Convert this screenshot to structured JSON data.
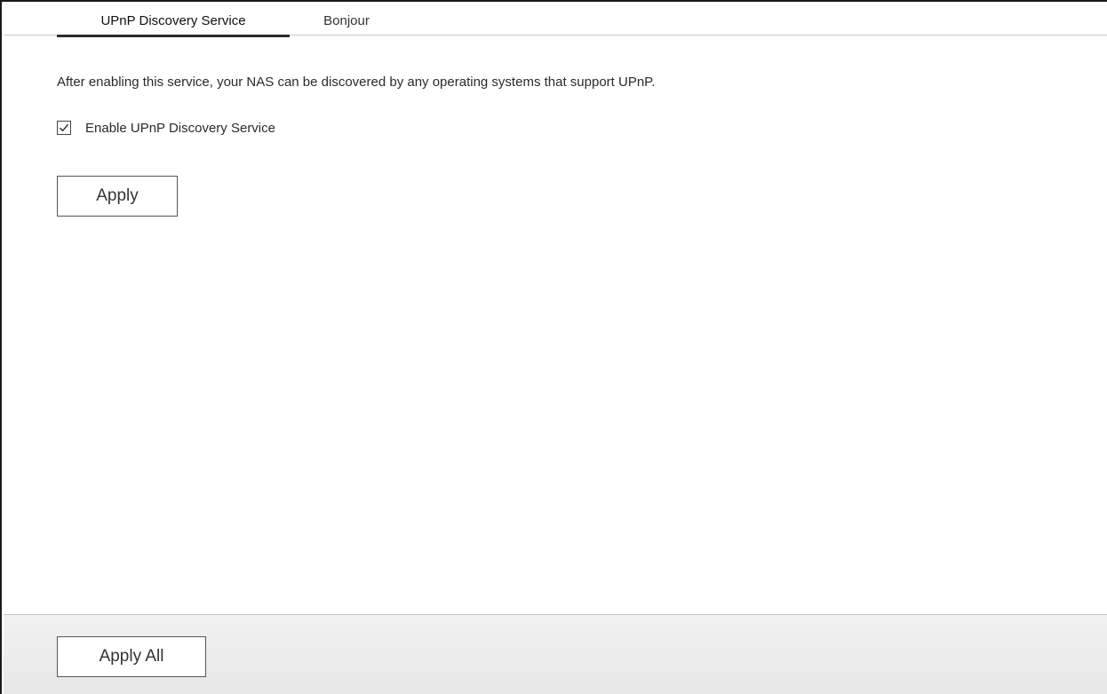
{
  "tabs": [
    {
      "label": "UPnP Discovery Service",
      "active": true
    },
    {
      "label": "Bonjour",
      "active": false
    }
  ],
  "content": {
    "description": "After enabling this service, your NAS can be discovered by any operating systems that support UPnP.",
    "checkbox": {
      "label": "Enable UPnP Discovery Service",
      "checked": true
    },
    "apply_label": "Apply"
  },
  "footer": {
    "apply_all_label": "Apply All"
  },
  "icons": {
    "checkbox_mark": "checkmark-icon"
  },
  "colors": {
    "active_tab_underline": "#2b2b2b",
    "footer_bg": "#ececec",
    "button_border": "#555555"
  }
}
